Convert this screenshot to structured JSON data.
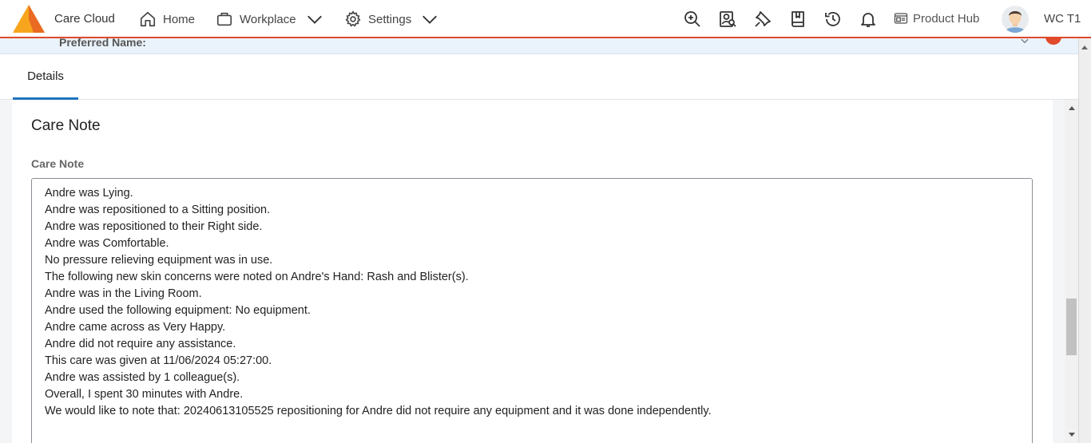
{
  "app": {
    "brand_name": "Care Cloud",
    "accent_color": "#e04a2b",
    "logo_colors": [
      "#f7a51c",
      "#e96b22"
    ]
  },
  "nav": {
    "home_label": "Home",
    "workplace_label": "Workplace",
    "settings_label": "Settings"
  },
  "toolbar": {
    "icons": [
      "zoom-in-icon",
      "person-search-icon",
      "pin-icon",
      "book-icon",
      "history-icon",
      "bell-icon"
    ],
    "product_hub_label": "Product Hub",
    "user_initials": "WC T1"
  },
  "resident": {
    "preferred_name_label": "Preferred Name:"
  },
  "tabs": [
    {
      "label": "Details",
      "active": true
    }
  ],
  "care_note": {
    "section_title": "Care Note",
    "field_label": "Care Note",
    "lines": [
      "Andre was Lying.",
      "Andre was repositioned to a Sitting position.",
      "Andre was repositioned to their Right side.",
      "Andre was Comfortable.",
      "No pressure relieving equipment was in use.",
      "The following new skin concerns were noted on Andre's Hand: Rash and Blister(s).",
      "Andre was in the Living Room.",
      "Andre used the following equipment: No equipment.",
      "Andre came across as Very Happy.",
      "Andre did not require any assistance.",
      "This care was given at 11/06/2024 05:27:00.",
      "Andre was assisted by 1 colleague(s).",
      "Overall, I spent 30 minutes with Andre.",
      "We would like to note that: 20240613105525 repositioning for Andre did not require any equipment and it was done independently."
    ]
  }
}
